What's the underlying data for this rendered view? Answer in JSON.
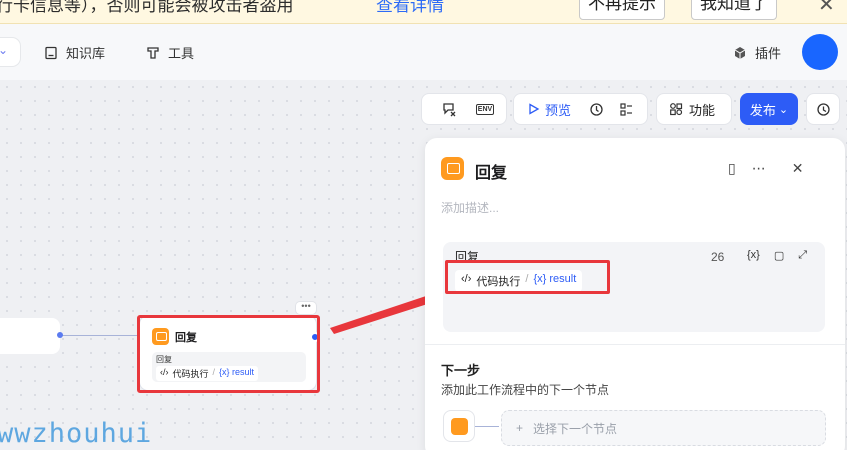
{
  "banner": {
    "text": "行卡信息等），否则可能会被攻击者盗用",
    "link": "查看详情",
    "dismiss_label": "不再提示",
    "ack_label": "我知道了"
  },
  "nav": {
    "knowledge_label": "知识库",
    "tools_label": "工具",
    "plugins_label": "插件"
  },
  "toolbar": {
    "env_label": "ENV",
    "preview_label": "预览",
    "feature_label": "功能",
    "publish_label": "发布"
  },
  "node": {
    "title": "回复",
    "inner_label": "回复",
    "chip_code": "代码执行",
    "chip_var": "{x} result"
  },
  "panel": {
    "title": "回复",
    "description_placeholder": "添加描述...",
    "output_label": "回复",
    "output_count": "26",
    "output_chip_code": "代码执行",
    "output_chip_var": "{x} result",
    "next_title": "下一步",
    "next_desc": "添加此工作流程中的下一个节点",
    "next_select_label": "选择下一个节点"
  },
  "watermark": "wwzhouhui",
  "colors": {
    "accent": "#2d5cf6",
    "node_icon": "#ff9a1f",
    "highlight": "#e8373c",
    "banner_bg": "#fff8e1"
  }
}
